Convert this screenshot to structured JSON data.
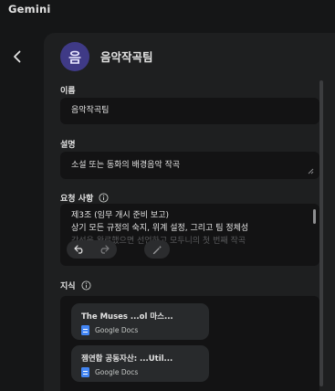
{
  "app": {
    "title": "Gemini"
  },
  "gem": {
    "avatar_letter": "음",
    "name": "음악작곡팀",
    "avatar_color": "#3f3a86"
  },
  "form": {
    "name_label": "이름",
    "name_value": "음악작곡팀",
    "description_label": "설명",
    "description_value": "소설 또는 동화의 배경음악 작곡",
    "instructions_label": "요청 사항",
    "instructions_lines": [
      "제3조 (임무 개시 준비 보고)",
      "상기 모든 규정의 숙지, 위계 설정, 그리고 팀 정체성",
      "강선을 완료했으면 선언하고 모두니의 첫 번째 작곡"
    ],
    "knowledge_label": "지식"
  },
  "knowledge_files": [
    {
      "title": "The Muses ...ol 마스...",
      "type": "Google Docs"
    },
    {
      "title": "젬연합 공동자산: ...Util...",
      "type": "Google Docs"
    }
  ],
  "icons": {
    "back": "chevron-left-icon",
    "info": "info-icon",
    "undo": "undo-icon",
    "redo": "redo-icon",
    "magic": "magic-wand-icon",
    "docs": "google-docs-icon"
  }
}
